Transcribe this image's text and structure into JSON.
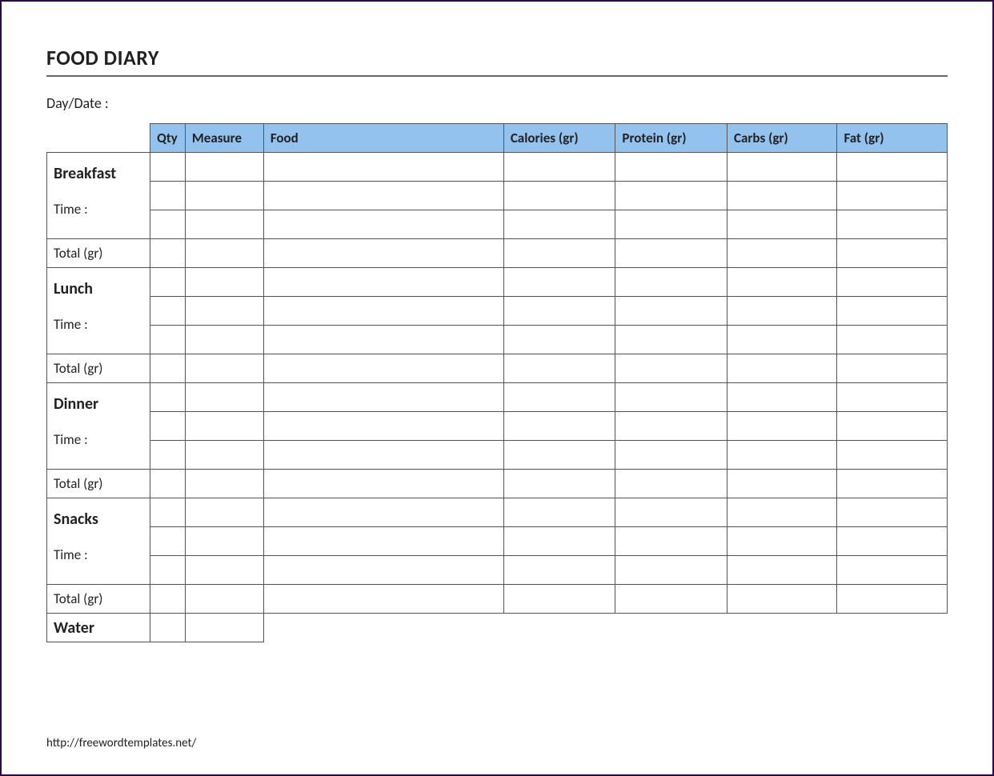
{
  "title": "FOOD DIARY",
  "day_date_label": "Day/Date :",
  "headers": {
    "qty": "Qty",
    "measure": "Measure",
    "food": "Food",
    "calories": "Calories (gr)",
    "protein": "Protein (gr)",
    "carbs": "Carbs (gr)",
    "fat": "Fat (gr)"
  },
  "sections": {
    "breakfast": {
      "label": "Breakfast",
      "time_label": "Time :",
      "total_label": "Total (gr)"
    },
    "lunch": {
      "label": "Lunch",
      "time_label": "Time :",
      "total_label": "Total (gr)"
    },
    "dinner": {
      "label": "Dinner",
      "time_label": "Time :",
      "total_label": "Total (gr)"
    },
    "snacks": {
      "label": "Snacks",
      "time_label": "Time :",
      "total_label": "Total (gr)"
    }
  },
  "water_label": "Water",
  "footer_url": "http://freewordtemplates.net/"
}
